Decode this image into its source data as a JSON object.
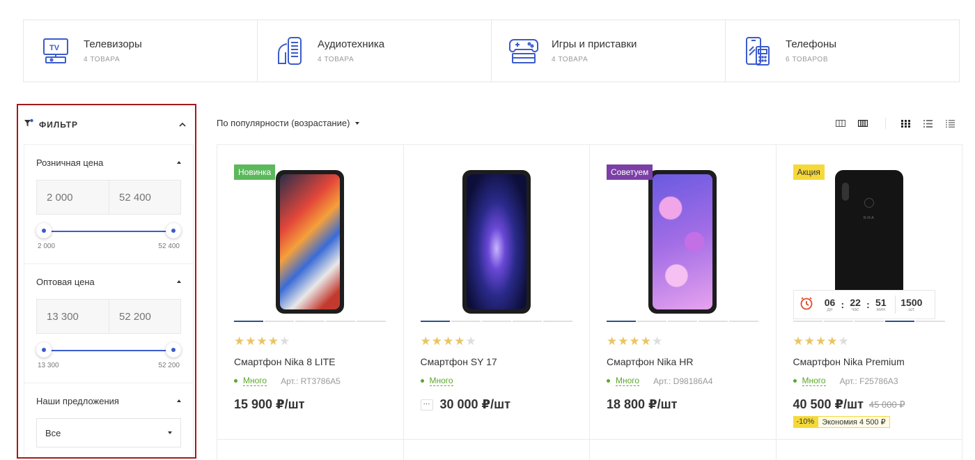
{
  "categories": [
    {
      "name": "Телевизоры",
      "count": "4 ТОВАРА",
      "icon": "tv-icon"
    },
    {
      "name": "Аудиотехника",
      "count": "4 ТОВАРА",
      "icon": "speaker-icon"
    },
    {
      "name": "Игры и приставки",
      "count": "4 ТОВАРА",
      "icon": "gamepad-icon"
    },
    {
      "name": "Телефоны",
      "count": "6 ТОВАРОВ",
      "icon": "phone-icon"
    }
  ],
  "filter": {
    "title": "ФИЛЬТР",
    "retail": {
      "label": "Розничная цена",
      "from": "2 000",
      "to": "52 400",
      "min_label": "2 000",
      "max_label": "52 400"
    },
    "wholesale": {
      "label": "Оптовая цена",
      "from": "13 300",
      "to": "52 200",
      "min_label": "13 300",
      "max_label": "52 200"
    },
    "offers": {
      "label": "Наши предложения",
      "selected": "Все"
    }
  },
  "sort": {
    "label": "По популярности (возрастание)"
  },
  "colors": {
    "accent": "#3b5bcc",
    "new": "#5cb85c",
    "recommend": "#7b3fa6",
    "sale": "#f5d93a",
    "stock": "#5aa82a"
  },
  "products": [
    {
      "badge": "Новинка",
      "title": "Смартфон Nika 8 LITE",
      "stock": "Много",
      "article": "Арт.: RT3786A5",
      "price": "15 900 ₽/шт",
      "rating": 4
    },
    {
      "badge": "",
      "title": "Смартфон SY 17",
      "stock": "Много",
      "article": "",
      "price": "30 000 ₽/шт",
      "more": "···",
      "rating": 4
    },
    {
      "badge": "Советуем",
      "title": "Смартфон Nika HR",
      "stock": "Много",
      "article": "Арт.: D98186A4",
      "price": "18 800 ₽/шт",
      "rating": 4
    },
    {
      "badge": "Акция",
      "title": "Смартфон Nika Premium",
      "stock": "Много",
      "article": "Арт.: F25786A3",
      "price": "40 500 ₽/шт",
      "old_price": "45 000 ₽",
      "discount": "-10%",
      "saving": "Экономия 4 500 ₽",
      "rating": 4,
      "brand": "NIKA",
      "timer": {
        "days": "06",
        "days_label": "дн",
        "hours": "22",
        "hours_label": "час",
        "minutes": "51",
        "minutes_label": "мин",
        "qty": "1500",
        "qty_label": "шт"
      }
    }
  ]
}
